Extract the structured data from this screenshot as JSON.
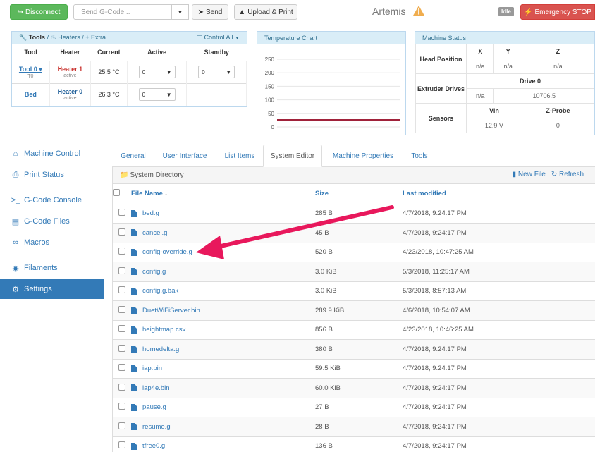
{
  "header": {
    "disconnect_label": "Disconnect",
    "gcode_placeholder": "Send G-Code...",
    "send_label": "Send",
    "upload_label": "Upload & Print",
    "machine_name": "Artemis",
    "status_badge": "Idle",
    "estop_label": "Emergency STOP"
  },
  "tools_panel": {
    "tools_label": "Tools",
    "heaters_label": "Heaters",
    "extra_label": "Extra",
    "control_all_label": "Control All",
    "columns": [
      "Tool",
      "Heater",
      "Current",
      "Active",
      "Standby"
    ],
    "rows": [
      {
        "tool": "Tool 0",
        "tool_sub": "T0",
        "heater": "Heater 1",
        "heater_sub": "active",
        "current": "25.5 °C",
        "active": "0",
        "standby": "0"
      },
      {
        "tool": "Bed",
        "tool_sub": "",
        "heater": "Heater 0",
        "heater_sub": "active",
        "current": "26.3 °C",
        "active": "0",
        "standby": ""
      }
    ]
  },
  "temp_chart": {
    "title": "Temperature Chart",
    "chart_data": {
      "type": "line",
      "title": "Temperature Chart",
      "ylim": [
        0,
        250
      ],
      "y_ticks": [
        "250",
        "200",
        "150",
        "100",
        "50",
        "0"
      ],
      "series": [
        {
          "color": "#a0223a",
          "values": [
            26,
            26,
            26,
            26,
            26
          ]
        }
      ],
      "grid": true
    }
  },
  "machine_status": {
    "title": "Machine Status",
    "head_label": "Head Position",
    "axes": [
      "X",
      "Y",
      "Z"
    ],
    "axis_values": [
      "n/a",
      "n/a",
      "n/a"
    ],
    "extruder_label": "Extruder Drives",
    "drive_label": "Drive 0",
    "drive_values": [
      "n/a",
      "10706.5"
    ],
    "sensors_label": "Sensors",
    "sensor_headers": [
      "Vin",
      "Z-Probe"
    ],
    "sensor_values": [
      "12.9 V",
      "0"
    ]
  },
  "sidebar": {
    "items": [
      {
        "label": "Machine Control",
        "icon": "home-icon"
      },
      {
        "label": "Print Status",
        "icon": "printer-icon"
      },
      {
        "label": "G-Code Console",
        "icon": "terminal-icon"
      },
      {
        "label": "G-Code Files",
        "icon": "files-icon"
      },
      {
        "label": "Macros",
        "icon": "link-icon"
      },
      {
        "label": "Filaments",
        "icon": "disc-icon"
      },
      {
        "label": "Settings",
        "icon": "gear-icon"
      }
    ]
  },
  "tabs": [
    "General",
    "User Interface",
    "List Items",
    "System Editor",
    "Machine Properties",
    "Tools"
  ],
  "files": {
    "directory_label": "System Directory",
    "new_file_label": "New File",
    "refresh_label": "Refresh",
    "columns": [
      "File Name",
      "Size",
      "Last modified"
    ],
    "rows": [
      {
        "name": "bed.g",
        "size": "285 B",
        "date": "4/7/2018, 9:24:17 PM"
      },
      {
        "name": "cancel.g",
        "size": "45 B",
        "date": "4/7/2018, 9:24:17 PM"
      },
      {
        "name": "config-override.g",
        "size": "520 B",
        "date": "4/23/2018, 10:47:25 AM"
      },
      {
        "name": "config.g",
        "size": "3.0 KiB",
        "date": "5/3/2018, 11:25:17 AM"
      },
      {
        "name": "config.g.bak",
        "size": "3.0 KiB",
        "date": "5/3/2018, 8:57:13 AM"
      },
      {
        "name": "DuetWiFiServer.bin",
        "size": "289.9 KiB",
        "date": "4/6/2018, 10:54:07 AM"
      },
      {
        "name": "heightmap.csv",
        "size": "856 B",
        "date": "4/23/2018, 10:46:25 AM"
      },
      {
        "name": "homedelta.g",
        "size": "380 B",
        "date": "4/7/2018, 9:24:17 PM"
      },
      {
        "name": "iap.bin",
        "size": "59.5 KiB",
        "date": "4/7/2018, 9:24:17 PM"
      },
      {
        "name": "iap4e.bin",
        "size": "60.0 KiB",
        "date": "4/7/2018, 9:24:17 PM"
      },
      {
        "name": "pause.g",
        "size": "27 B",
        "date": "4/7/2018, 9:24:17 PM"
      },
      {
        "name": "resume.g",
        "size": "28 B",
        "date": "4/7/2018, 9:24:17 PM"
      },
      {
        "name": "tfree0.g",
        "size": "136 B",
        "date": "4/7/2018, 9:24:17 PM"
      }
    ]
  },
  "colors": {
    "primary": "#337ab7",
    "success": "#5cb85c",
    "danger": "#d9534f",
    "arrow": "#e8185c"
  }
}
